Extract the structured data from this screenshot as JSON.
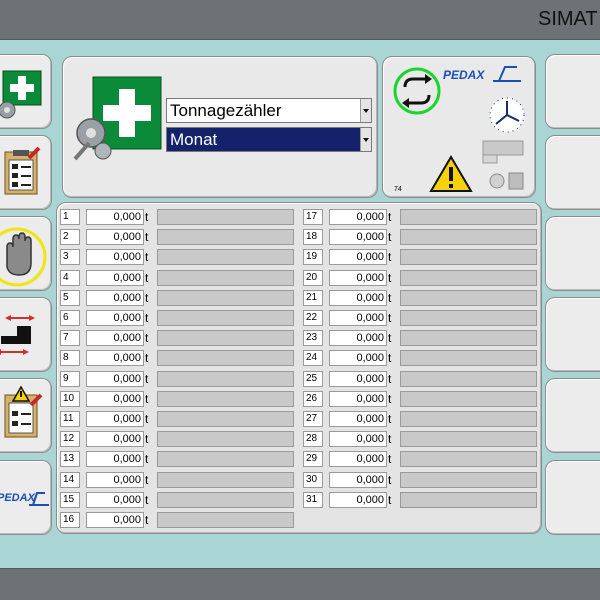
{
  "window": {
    "brand": "SIMAT"
  },
  "header": {
    "dropdown_primary": {
      "value": "Tonnagezähler"
    },
    "dropdown_secondary": {
      "value": "Monat"
    }
  },
  "status": {
    "brand_logo": "PEDAX",
    "screen_number": "74",
    "icons": [
      "refresh-cycle-icon",
      "clock-icon",
      "warning-triangle-icon",
      "machine-parts-icon",
      "pedax-logo-icon"
    ]
  },
  "sidebar": {
    "buttons": [
      {
        "name": "first-aid-settings-button",
        "icon": "first-aid-gear-icon"
      },
      {
        "name": "checklist-edit-button",
        "icon": "checklist-pencil-icon"
      },
      {
        "name": "manual-mode-button",
        "icon": "hand-icon",
        "highlight": "#f0e60a"
      },
      {
        "name": "stop-position-button",
        "icon": "stop-position-icon"
      },
      {
        "name": "warning-checklist-button",
        "icon": "warning-checklist-icon"
      },
      {
        "name": "pedax-info-button",
        "icon": "pedax-logo-icon"
      }
    ]
  },
  "counters": {
    "unit": "t",
    "left": [
      {
        "num": "1",
        "value": "0,000"
      },
      {
        "num": "2",
        "value": "0,000"
      },
      {
        "num": "3",
        "value": "0,000"
      },
      {
        "num": "4",
        "value": "0,000"
      },
      {
        "num": "5",
        "value": "0,000"
      },
      {
        "num": "6",
        "value": "0,000"
      },
      {
        "num": "7",
        "value": "0,000"
      },
      {
        "num": "8",
        "value": "0,000"
      },
      {
        "num": "9",
        "value": "0,000"
      },
      {
        "num": "10",
        "value": "0,000"
      },
      {
        "num": "11",
        "value": "0,000"
      },
      {
        "num": "12",
        "value": "0,000"
      },
      {
        "num": "13",
        "value": "0,000"
      },
      {
        "num": "14",
        "value": "0,000"
      },
      {
        "num": "15",
        "value": "0,000"
      },
      {
        "num": "16",
        "value": "0,000"
      }
    ],
    "right": [
      {
        "num": "17",
        "value": "0,000"
      },
      {
        "num": "18",
        "value": "0,000"
      },
      {
        "num": "19",
        "value": "0,000"
      },
      {
        "num": "20",
        "value": "0,000"
      },
      {
        "num": "21",
        "value": "0,000"
      },
      {
        "num": "22",
        "value": "0,000"
      },
      {
        "num": "23",
        "value": "0,000"
      },
      {
        "num": "24",
        "value": "0,000"
      },
      {
        "num": "25",
        "value": "0,000"
      },
      {
        "num": "26",
        "value": "0,000"
      },
      {
        "num": "27",
        "value": "0,000"
      },
      {
        "num": "28",
        "value": "0,000"
      },
      {
        "num": "29",
        "value": "0,000"
      },
      {
        "num": "30",
        "value": "0,000"
      },
      {
        "num": "31",
        "value": "0,000"
      }
    ]
  },
  "colors": {
    "background": "#a9d5d5",
    "titlebar": "#6e7176",
    "first_aid_green": "#0b8a3a",
    "selection_navy": "#13226a",
    "refresh_ring": "#19d62c",
    "warning_yellow": "#f5d20a",
    "pedax_blue": "#1a4fb5"
  }
}
